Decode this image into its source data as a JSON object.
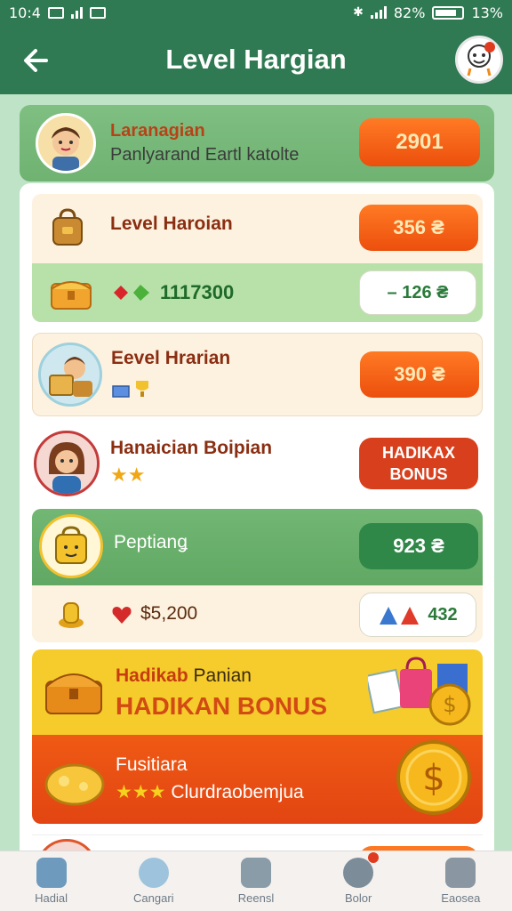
{
  "status_bar": {
    "time": "10:4",
    "battery_percent_label": "82%",
    "right_percent": "13%"
  },
  "header": {
    "title": "Level Hargian"
  },
  "top_card": {
    "title": "Laranagian",
    "subtitle": "Panlyarand Eartl katolte",
    "value": "2901"
  },
  "items": [
    {
      "label": "Level Haroian",
      "value": "356 ₴"
    },
    {
      "sub_value": "1117300",
      "pill": "– 126 ₴"
    },
    {
      "label": "Eevel Hrarian",
      "value": "390 ₴"
    },
    {
      "label": "Hanaician Boipian",
      "pill_line1": "HADIKAX",
      "pill_line2": "BONUS"
    },
    {
      "label": "Peptianǥ",
      "value": "923 ₴"
    },
    {
      "sub_value": "$5,200",
      "pill": "432"
    }
  ],
  "bonus_banner": {
    "line1a": "Hadikab",
    "line1b": "Panian",
    "line2": "HADIKAN BONUS"
  },
  "lower_banner": {
    "title": "Fusitiara",
    "subtitle": "Clurdraobemjua"
  },
  "bottom_nav": [
    {
      "label": "Hadial"
    },
    {
      "label": "Cangari"
    },
    {
      "label": "Reensl"
    },
    {
      "label": "Bolor"
    },
    {
      "label": "Eaosea"
    }
  ],
  "colors": {
    "header_green": "#2f7a52",
    "accent_orange": "#ef5a12",
    "bonus_yellow": "#f6cc2c",
    "bonus_red": "#e64a16"
  },
  "icons": [
    "back-arrow-icon",
    "chest-icon",
    "coin-icon",
    "star-icon",
    "home-icon",
    "clock-icon",
    "list-icon",
    "settings-icon",
    "menu-icon"
  ]
}
